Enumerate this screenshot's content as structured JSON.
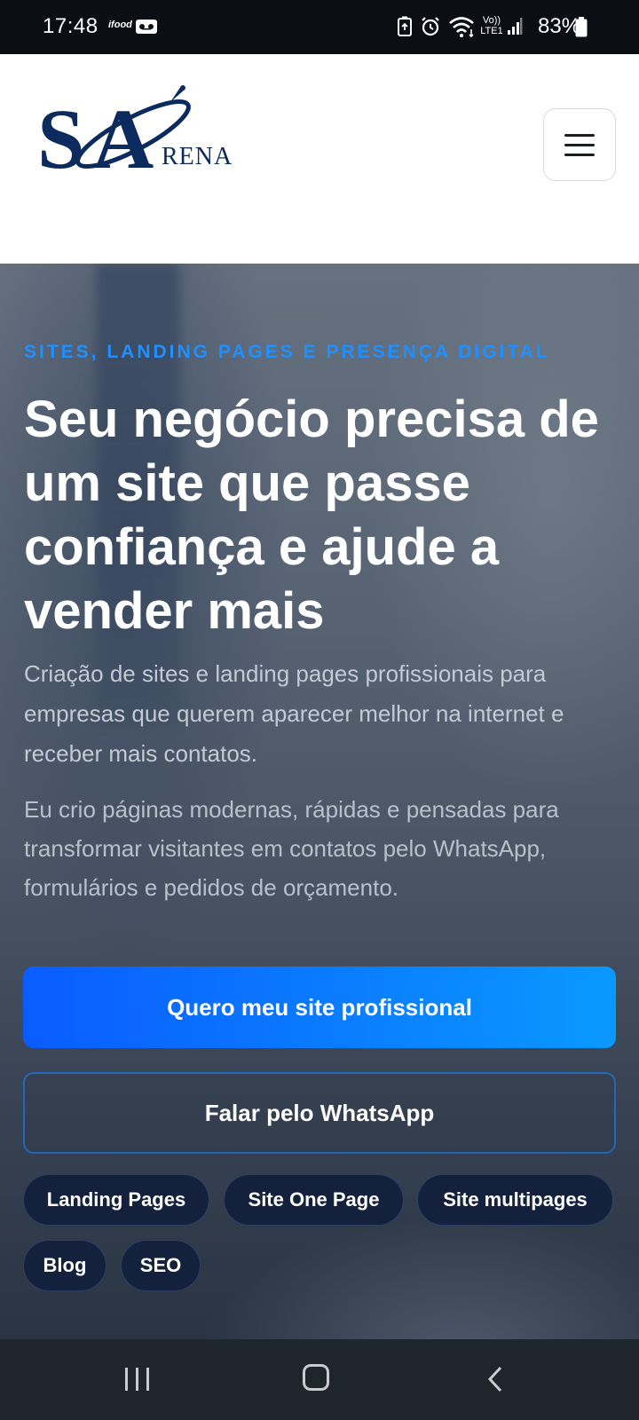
{
  "status_bar": {
    "time": "17:48",
    "ifood": "ifood",
    "battery": "83%",
    "icons": [
      "ifood-icon",
      "voicemail-icon",
      "battery-saver-icon",
      "alarm-icon",
      "wifi-icon",
      "volte-icon",
      "signal-icon",
      "battery-icon"
    ],
    "volte": "Vo))",
    "lte": "LTE1"
  },
  "header": {
    "logo_s": "S",
    "logo_a": "A",
    "logo_rena": "RENA",
    "menu_icon": "hamburger-menu-icon"
  },
  "hero": {
    "eyebrow": "SITES, LANDING PAGES E PRESENÇA DIGITAL",
    "headline": "Seu negócio precisa de um site que passe confiança e ajude a vender mais",
    "lead": "Criação de sites e landing pages profissionais para empresas que querem aparecer melhor na internet e receber mais contatos.",
    "lead2": "Eu crio páginas modernas, rápidas e pensadas para transformar visitantes em contatos pelo WhatsApp, formulários e pedidos de orçamento.",
    "primary_button": "Quero meu site profissional",
    "secondary_button": "Falar pelo WhatsApp",
    "chips": [
      "Landing Pages",
      "Site One Page",
      "Site multipages",
      "Blog",
      "SEO"
    ]
  },
  "colors": {
    "accent": "#1e90ff",
    "primary_button_start": "#0a5cff",
    "primary_button_end": "#0a99ff",
    "chip_bg": "#14213d",
    "logo_navy": "#0b2b5e"
  },
  "nav_bar": {
    "icons": [
      "recent-apps-icon",
      "home-icon",
      "back-icon"
    ]
  }
}
